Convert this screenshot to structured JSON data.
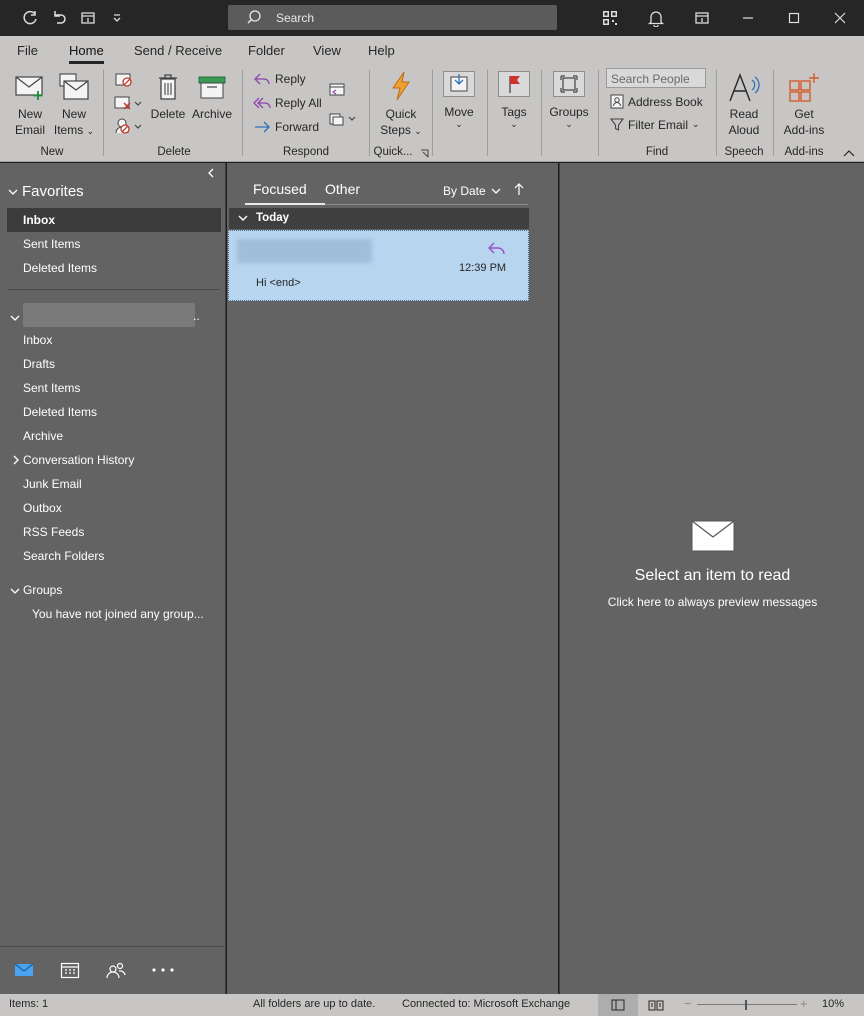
{
  "title_bar": {
    "search_placeholder": "Search",
    "icons": [
      "refresh-icon",
      "undo-icon",
      "touch-mode-icon",
      "customize-icon",
      "qr-code-icon",
      "bell-icon",
      "restore-ribbon-icon",
      "minimize-icon",
      "maximize-icon",
      "close-icon"
    ]
  },
  "ribbon_tabs": {
    "file": "File",
    "home": "Home",
    "send_receive": "Send / Receive",
    "folder": "Folder",
    "view": "View",
    "help": "Help"
  },
  "ribbon": {
    "new_email": [
      "New",
      "Email"
    ],
    "new_items": [
      "New",
      "Items"
    ],
    "group_new": "New",
    "delete": "Delete",
    "archive": "Archive",
    "group_delete": "Delete",
    "reply": "Reply",
    "reply_all": "Reply All",
    "forward": "Forward",
    "group_respond": "Respond",
    "quick_steps": [
      "Quick",
      "Steps"
    ],
    "group_quick": "Quick...",
    "move": "Move",
    "tags": "Tags",
    "groups": "Groups",
    "search_people": "Search People",
    "address_book": "Address Book",
    "filter_email": "Filter Email",
    "group_find": "Find",
    "read_aloud": [
      "Read",
      "Aloud"
    ],
    "group_speech": "Speech",
    "get_addins": [
      "Get",
      "Add-ins"
    ],
    "group_addins": "Add-ins"
  },
  "left_pane": {
    "favorites_header": "Favorites",
    "favorites": [
      "Inbox",
      "Sent Items",
      "Deleted Items"
    ],
    "account_folders": [
      "Inbox",
      "Drafts",
      "Sent Items",
      "Deleted Items",
      "Archive",
      "Conversation History",
      "Junk Email",
      "Outbox",
      "RSS Feeds",
      "Search Folders"
    ],
    "account_ellipsis": "..",
    "groups_header": "Groups",
    "groups_note": "You have not joined any group..."
  },
  "message_list": {
    "tab_focused": "Focused",
    "tab_other": "Other",
    "sort": "By Date",
    "group_today": "Today",
    "message": {
      "time": "12:39 PM",
      "preview": "Hi <end>"
    }
  },
  "reading_pane": {
    "title": "Select an item to read",
    "subtitle": "Click here to always preview messages"
  },
  "status_bar": {
    "items": "Items: 1",
    "sync": "All folders are up to date.",
    "connection": "Connected to: Microsoft Exchange",
    "zoom": "10%"
  },
  "colors": {
    "accent": "#0f6cbd",
    "ribbon_bg": "#c8c6c4",
    "pane_bg": "#636363",
    "selected_message": "#b7d5ef",
    "purple_reply": "#9a4fc7",
    "addins_orange": "#d45a2a"
  }
}
